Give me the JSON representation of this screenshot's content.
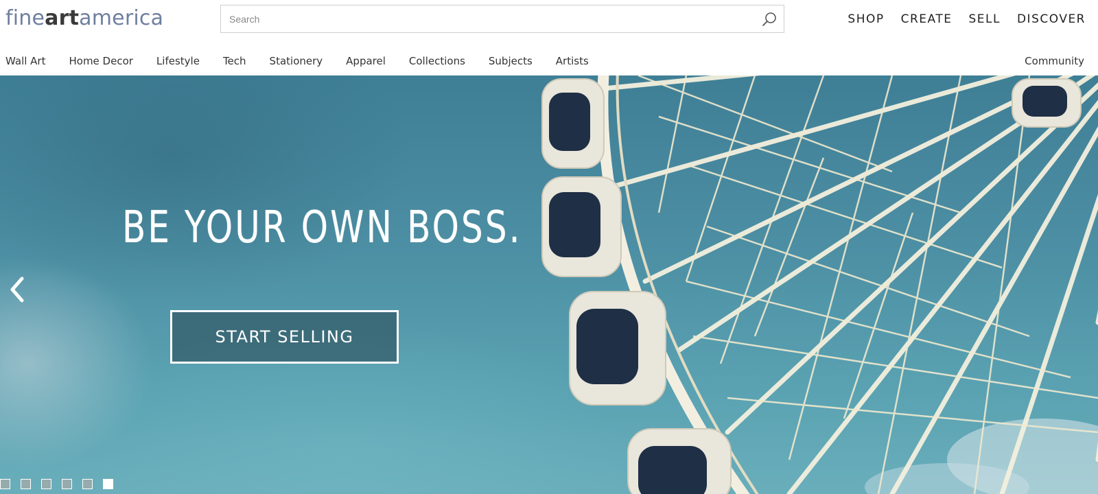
{
  "logo": {
    "part1": "fine",
    "part2": "art",
    "part3": "america"
  },
  "search": {
    "placeholder": "Search",
    "value": "",
    "icon": "search-icon"
  },
  "top_nav": [
    "SHOP",
    "CREATE",
    "SELL",
    "DISCOVER"
  ],
  "category_nav": [
    "Wall Art",
    "Home Decor",
    "Lifestyle",
    "Tech",
    "Stationery",
    "Apparel",
    "Collections",
    "Subjects",
    "Artists"
  ],
  "community_label": "Community",
  "hero": {
    "headline": "BE YOUR OWN BOSS.",
    "cta_label": "START SELLING",
    "prev_icon": "chevron-left-icon",
    "slide_count": 6,
    "active_slide": 6
  },
  "colors": {
    "logo_accent": "#6f7f9f",
    "sky": "#4c8ea3",
    "wheel": "#f4f0de"
  }
}
